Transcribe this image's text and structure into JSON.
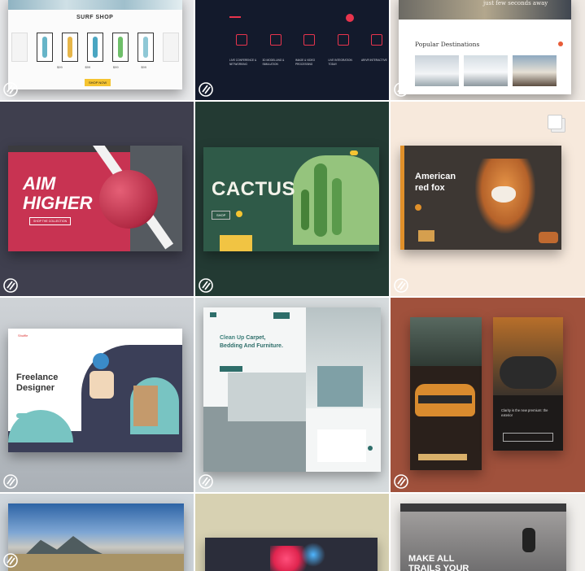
{
  "grid": {
    "tiles": [
      {
        "id": "surf-shop",
        "title": "SURF SHOP",
        "button": "SHOP NOW",
        "prices": [
          "$99",
          "$99",
          "$99",
          "$99"
        ]
      },
      {
        "id": "dark-services",
        "steps": [
          "LIVE CONFERENCE & NETWORKING",
          "3D MODELLING & SIMULATION",
          "IMAGE & VIDEO PROCESSING",
          "LIVE INTEGRATION TODAY",
          "AR/VR INTERACTIVE"
        ]
      },
      {
        "id": "travel",
        "banner": "just few seconds away",
        "title": "Popular Destinations"
      },
      {
        "id": "aim-higher",
        "headline_1": "AIM",
        "headline_2": "HIGHER",
        "cta": "SHOP THE COLLECTION"
      },
      {
        "id": "cactus",
        "title": "CACTUS",
        "cta": "SHOP"
      },
      {
        "id": "fox",
        "title_1": "American",
        "title_2": "red fox"
      },
      {
        "id": "freelance",
        "brand": "Shuffle",
        "title_1": "Freelance",
        "title_2": "Designer"
      },
      {
        "id": "clean-up",
        "title_1": "Clean Up",
        "title_2": "Carpet,",
        "title_3": "Bedding And Furniture."
      },
      {
        "id": "audi",
        "caption": "Clarity is the new premium: the exterior"
      },
      {
        "id": "landscape"
      },
      {
        "id": "nike"
      },
      {
        "id": "trails",
        "title_1": "MAKE ALL",
        "title_2": "TRAILS YOUR"
      }
    ]
  },
  "colors": {
    "accent_yellow": "#f5c431",
    "accent_red": "#e8344d",
    "green_dark": "#1f4a3c",
    "fox_orange": "#e0902a",
    "link_badge": "#ffffff"
  }
}
